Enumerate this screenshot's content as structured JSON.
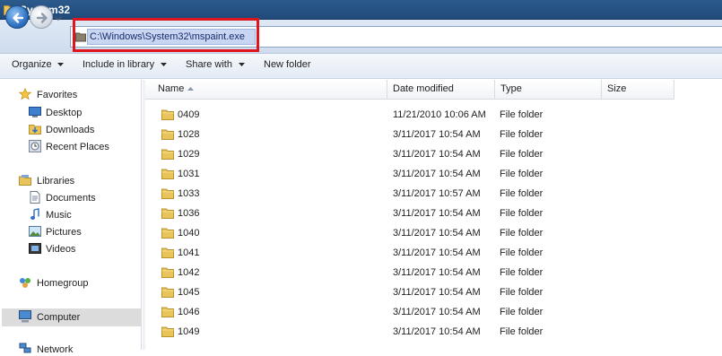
{
  "window": {
    "title": "System32"
  },
  "address": {
    "path": "C:\\Windows\\System32\\mspaint.exe",
    "highlight_color": "#e0141c"
  },
  "toolbar": {
    "organize": "Organize",
    "include_in_library": "Include in library",
    "share_with": "Share with",
    "new_folder": "New folder"
  },
  "sidebar": {
    "favorites": "Favorites",
    "desktop": "Desktop",
    "downloads": "Downloads",
    "recent_places": "Recent Places",
    "libraries": "Libraries",
    "documents": "Documents",
    "music": "Music",
    "pictures": "Pictures",
    "videos": "Videos",
    "homegroup": "Homegroup",
    "computer": "Computer",
    "network": "Network"
  },
  "columns": {
    "name": "Name",
    "date_modified": "Date modified",
    "type": "Type",
    "size": "Size"
  },
  "files": [
    {
      "name": "0409",
      "date": "11/21/2010 10:06 AM",
      "type": "File folder"
    },
    {
      "name": "1028",
      "date": "3/11/2017 10:54 AM",
      "type": "File folder"
    },
    {
      "name": "1029",
      "date": "3/11/2017 10:54 AM",
      "type": "File folder"
    },
    {
      "name": "1031",
      "date": "3/11/2017 10:54 AM",
      "type": "File folder"
    },
    {
      "name": "1033",
      "date": "3/11/2017 10:57 AM",
      "type": "File folder"
    },
    {
      "name": "1036",
      "date": "3/11/2017 10:54 AM",
      "type": "File folder"
    },
    {
      "name": "1040",
      "date": "3/11/2017 10:54 AM",
      "type": "File folder"
    },
    {
      "name": "1041",
      "date": "3/11/2017 10:54 AM",
      "type": "File folder"
    },
    {
      "name": "1042",
      "date": "3/11/2017 10:54 AM",
      "type": "File folder"
    },
    {
      "name": "1045",
      "date": "3/11/2017 10:54 AM",
      "type": "File folder"
    },
    {
      "name": "1046",
      "date": "3/11/2017 10:54 AM",
      "type": "File folder"
    },
    {
      "name": "1049",
      "date": "3/11/2017 10:54 AM",
      "type": "File folder"
    }
  ]
}
